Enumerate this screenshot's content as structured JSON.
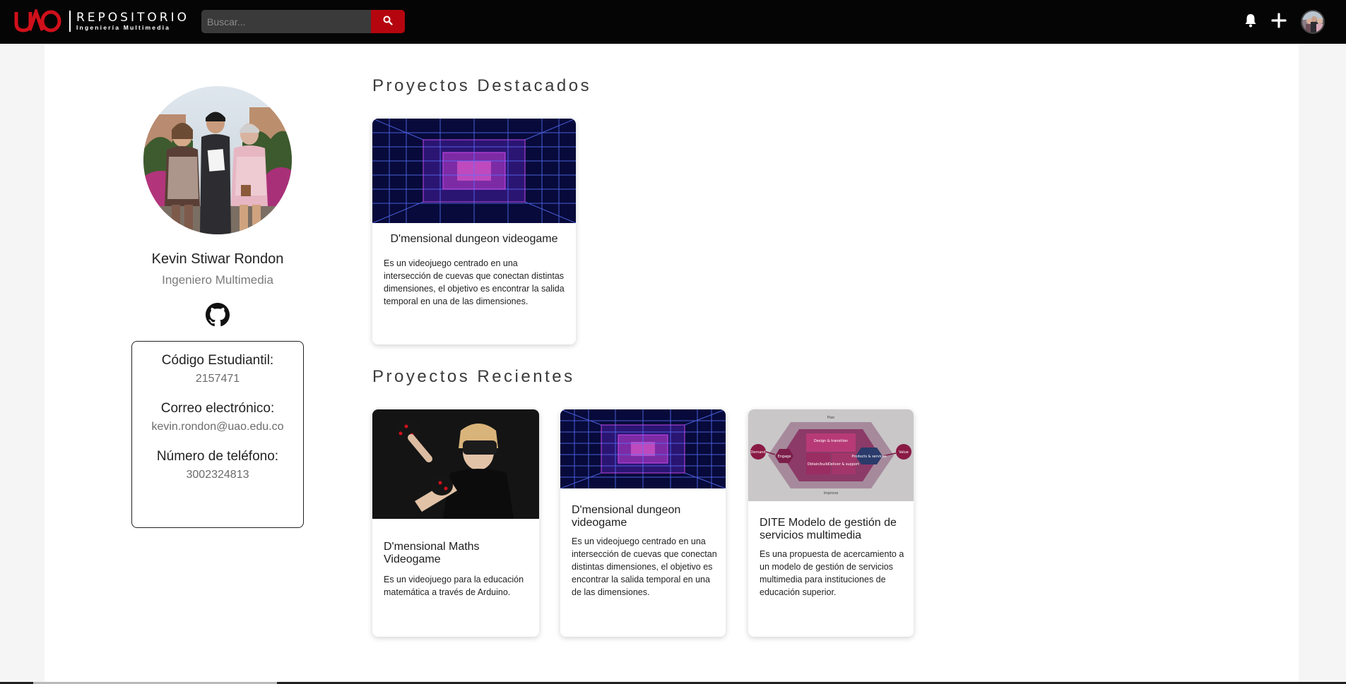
{
  "header": {
    "logo_title": "REPOSITORIO",
    "logo_subtitle": "Ingeniería Multimedia",
    "search_placeholder": "Buscar...",
    "icons": [
      "bell-icon",
      "plus-icon",
      "search-icon"
    ]
  },
  "profile": {
    "name": "Kevin Stiwar Rondon",
    "role": "Ingeniero Multimedia",
    "github_icon": "github-icon",
    "info": [
      {
        "label": "Código Estudiantil:",
        "value": "2157471"
      },
      {
        "label": "Correo electrónico:",
        "value": "kevin.rondon@uao.edu.co"
      },
      {
        "label": "Número de teléfono:",
        "value": "3002324813"
      }
    ]
  },
  "featured": {
    "title": "Proyectos Destacados",
    "cards": [
      {
        "title": "D'mensional dungeon videogame",
        "description": "Es un videojuego centrado en una intersección de cuevas que conectan distintas dimensiones, el objetivo es encontrar la salida temporal en una de las dimensiones."
      }
    ]
  },
  "recent": {
    "title": "Proyectos Recientes",
    "cards": [
      {
        "title": "D'mensional Maths Videogame",
        "description": "Es un videojuego para la educación matemática a través de Arduino."
      },
      {
        "title": "D'mensional dungeon videogame",
        "description": "Es un videojuego centrado en una intersección de cuevas que conectan distintas dimensiones, el objetivo es encontrar la salida temporal en una de las dimensiones."
      },
      {
        "title": "DITE Modelo de gestión de servicios multimedia",
        "description": "Es una propuesta de acercamiento a un modelo de gestión de servicios multimedia para instituciones de educación superior."
      }
    ]
  },
  "diagram": {
    "nodes": [
      "Plan",
      "Design & transition",
      "Obtain/build",
      "Deliver & support",
      "Demand",
      "Engage",
      "Products & services",
      "Value",
      "Improve"
    ]
  },
  "colors": {
    "topbar": "#050505",
    "accent": "#b5060f",
    "panel": "#ffffff",
    "background": "#f5f5f5"
  }
}
